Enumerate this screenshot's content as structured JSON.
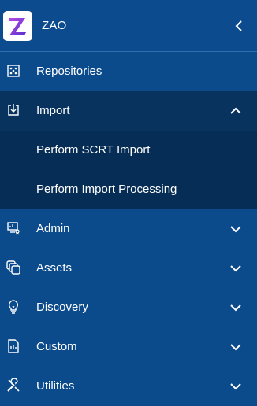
{
  "header": {
    "app_name": "ZAO",
    "logo_icon": "zao-logo",
    "collapse_icon": "chevron-left-icon"
  },
  "nav": {
    "items": [
      {
        "label": "Repositories",
        "icon": "repositories-icon",
        "expandable": false
      },
      {
        "label": "Import",
        "icon": "import-icon",
        "expandable": true,
        "expanded": true,
        "children": [
          {
            "label": "Perform SCRT Import"
          },
          {
            "label": "Perform Import Processing"
          }
        ]
      },
      {
        "label": "Admin",
        "icon": "admin-icon",
        "expandable": true,
        "expanded": false
      },
      {
        "label": "Assets",
        "icon": "assets-icon",
        "expandable": true,
        "expanded": false
      },
      {
        "label": "Discovery",
        "icon": "discovery-icon",
        "expandable": true,
        "expanded": false
      },
      {
        "label": "Custom",
        "icon": "custom-icon",
        "expandable": true,
        "expanded": false
      },
      {
        "label": "Utilities",
        "icon": "utilities-icon",
        "expandable": true,
        "expanded": false
      }
    ]
  },
  "colors": {
    "sidebar_bg": "#0b4a8b",
    "expanded_bg": "#08335f",
    "submenu_bg": "#062d55",
    "text": "#ffffff",
    "logo_purple": "#7a3fe0"
  }
}
